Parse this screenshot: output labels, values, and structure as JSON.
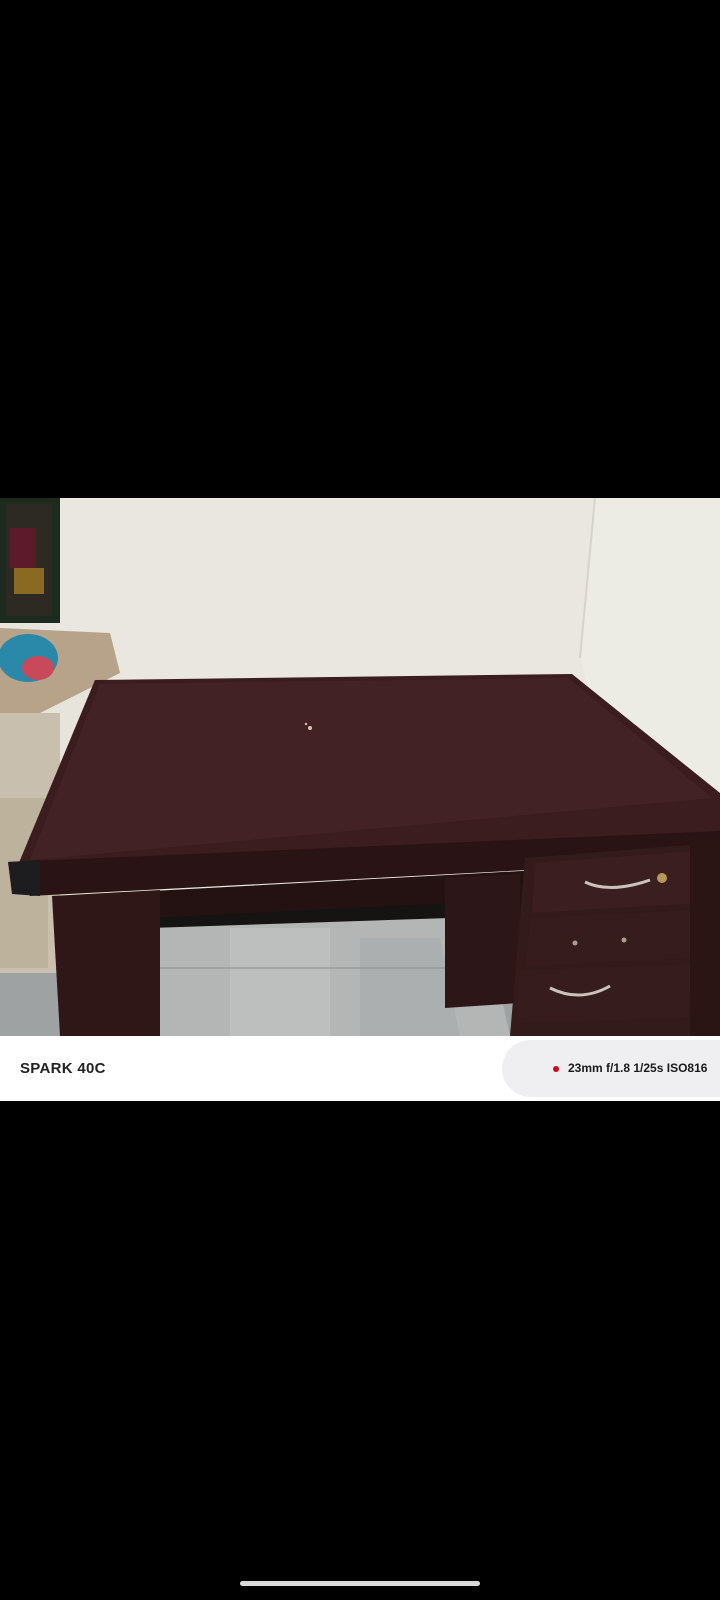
{
  "watermark": {
    "device_name": "SPARK 40C",
    "exif": "23mm f/1.8 1/25s ISO816",
    "accent_color": "#d0021b"
  },
  "photo": {
    "subject": "wooden-desk-photo"
  }
}
